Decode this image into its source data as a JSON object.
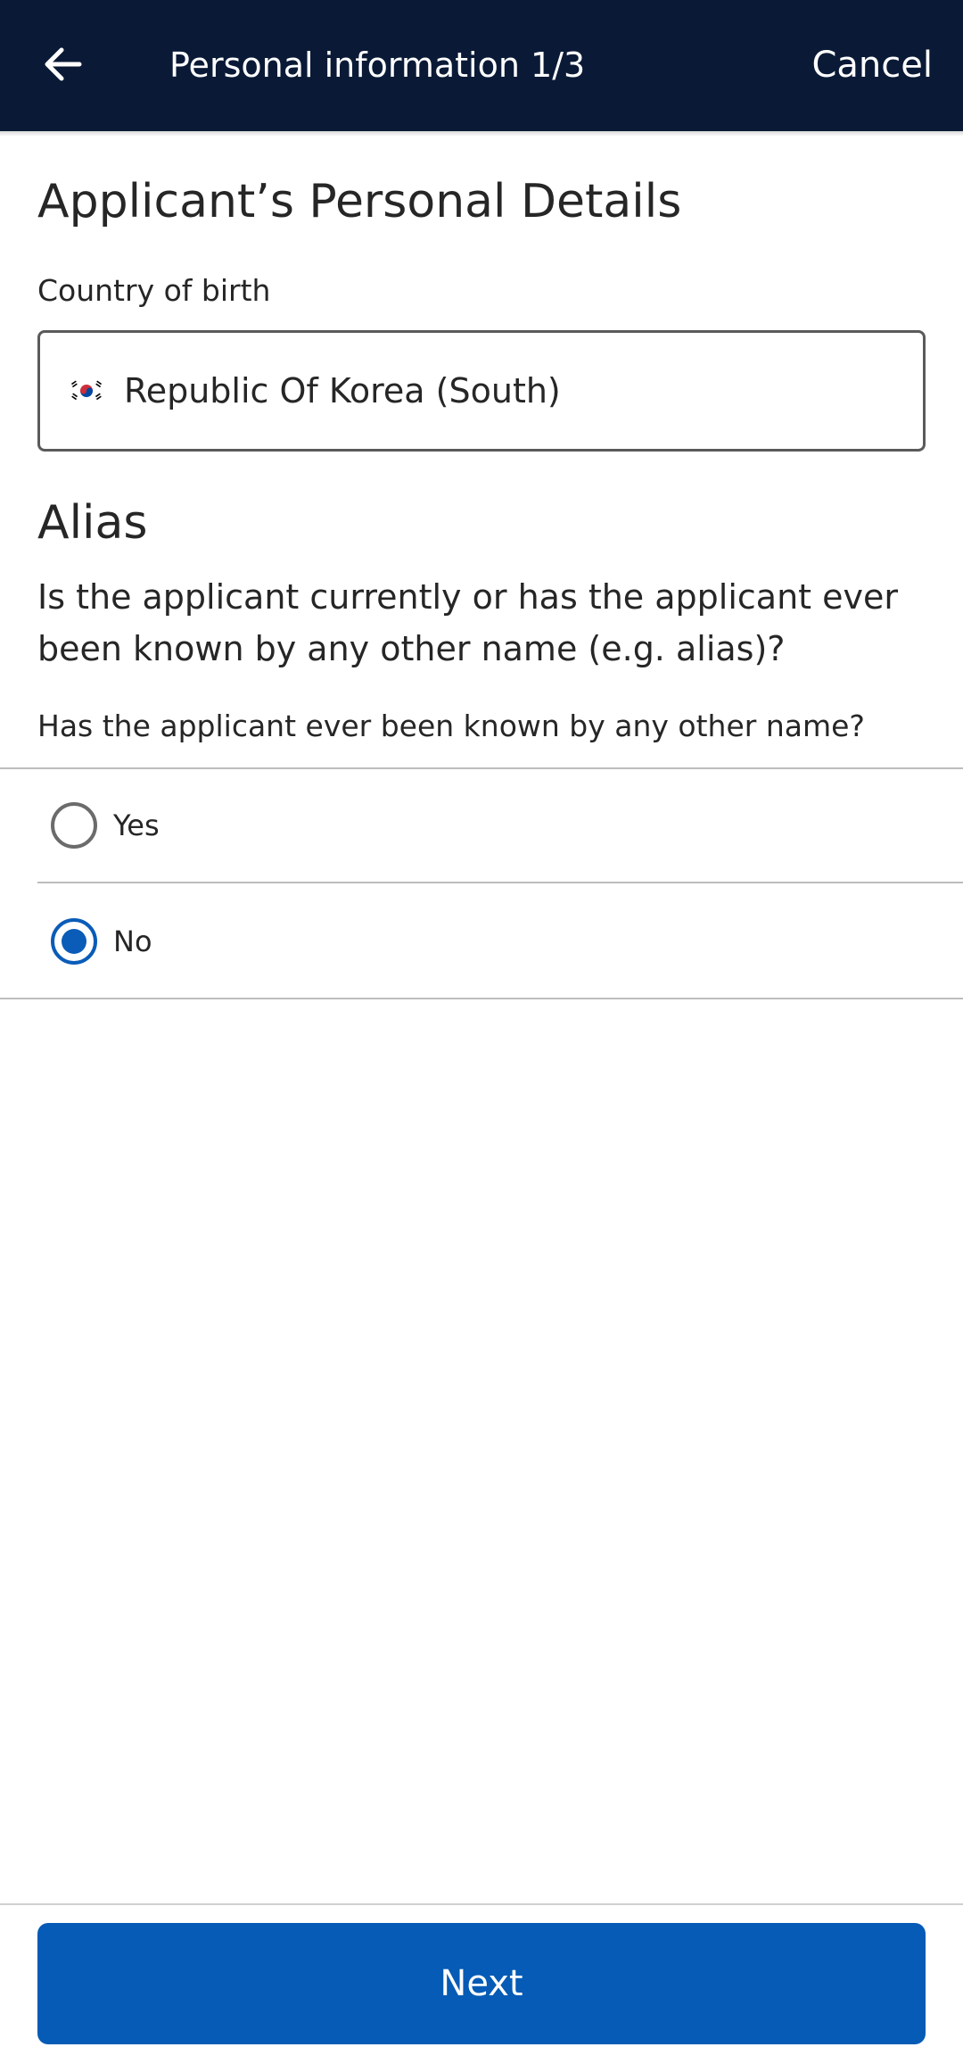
{
  "header": {
    "back_icon": "arrow-left-icon",
    "title": "Personal information 1/3",
    "cancel_label": "Cancel"
  },
  "section": {
    "title": "Applicant’s Personal Details"
  },
  "country_field": {
    "label": "Country of birth",
    "flag_icon": "south-korea-flag-icon",
    "value": "Republic Of Korea (South)"
  },
  "alias": {
    "title": "Alias",
    "question": "Is the applicant currently or has the applicant ever been known by any other name (e.g. alias)?",
    "group_label": "Has the applicant ever been known by any other name?",
    "options": [
      {
        "label": "Yes",
        "selected": false
      },
      {
        "label": "No",
        "selected": true
      }
    ]
  },
  "footer": {
    "next_label": "Next"
  },
  "colors": {
    "header_bg": "#0a1a36",
    "accent": "#055bb5",
    "radio_checked": "#0a5cb8"
  }
}
